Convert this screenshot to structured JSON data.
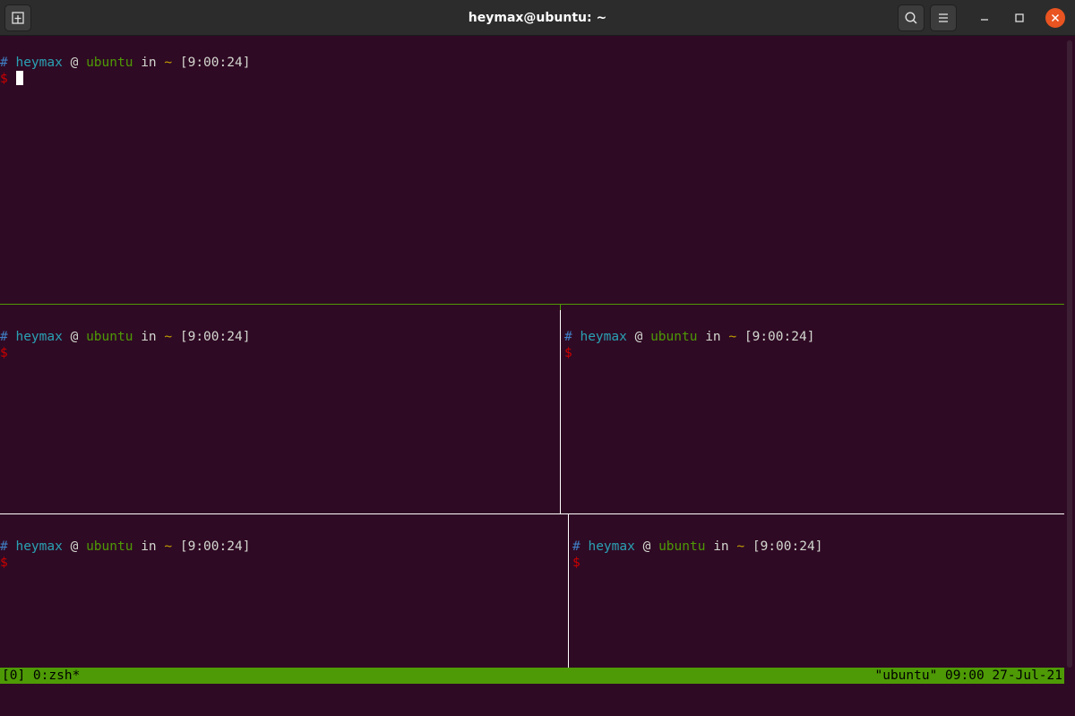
{
  "window": {
    "title": "heymax@ubuntu: ~",
    "new_tab_icon": "new-tab-icon",
    "search_icon": "search-icon",
    "menu_icon": "hamburger-menu-icon",
    "minimize_icon": "minimize-icon",
    "maximize_icon": "maximize-icon",
    "close_icon": "close-icon",
    "accent_color": "#e95420"
  },
  "prompt": {
    "hash": "#",
    "user": "heymax",
    "at": "@",
    "host": "ubuntu",
    "in": "in",
    "dir": "~",
    "time": "[9:00:24]",
    "dollar": "$"
  },
  "panes": [
    {
      "id": "top",
      "active": true
    },
    {
      "id": "middle-left",
      "active": false
    },
    {
      "id": "middle-right",
      "active": false
    },
    {
      "id": "bottom-left",
      "active": false
    },
    {
      "id": "bottom-right",
      "active": false
    }
  ],
  "status": {
    "left": "[0] 0:zsh*",
    "right": "\"ubuntu\" 09:00 27-Jul-21",
    "color": "#4e9a06"
  },
  "colors": {
    "background": "#2f0a24",
    "active_border": "#4e9a06",
    "inactive_border": "#ffffff"
  }
}
